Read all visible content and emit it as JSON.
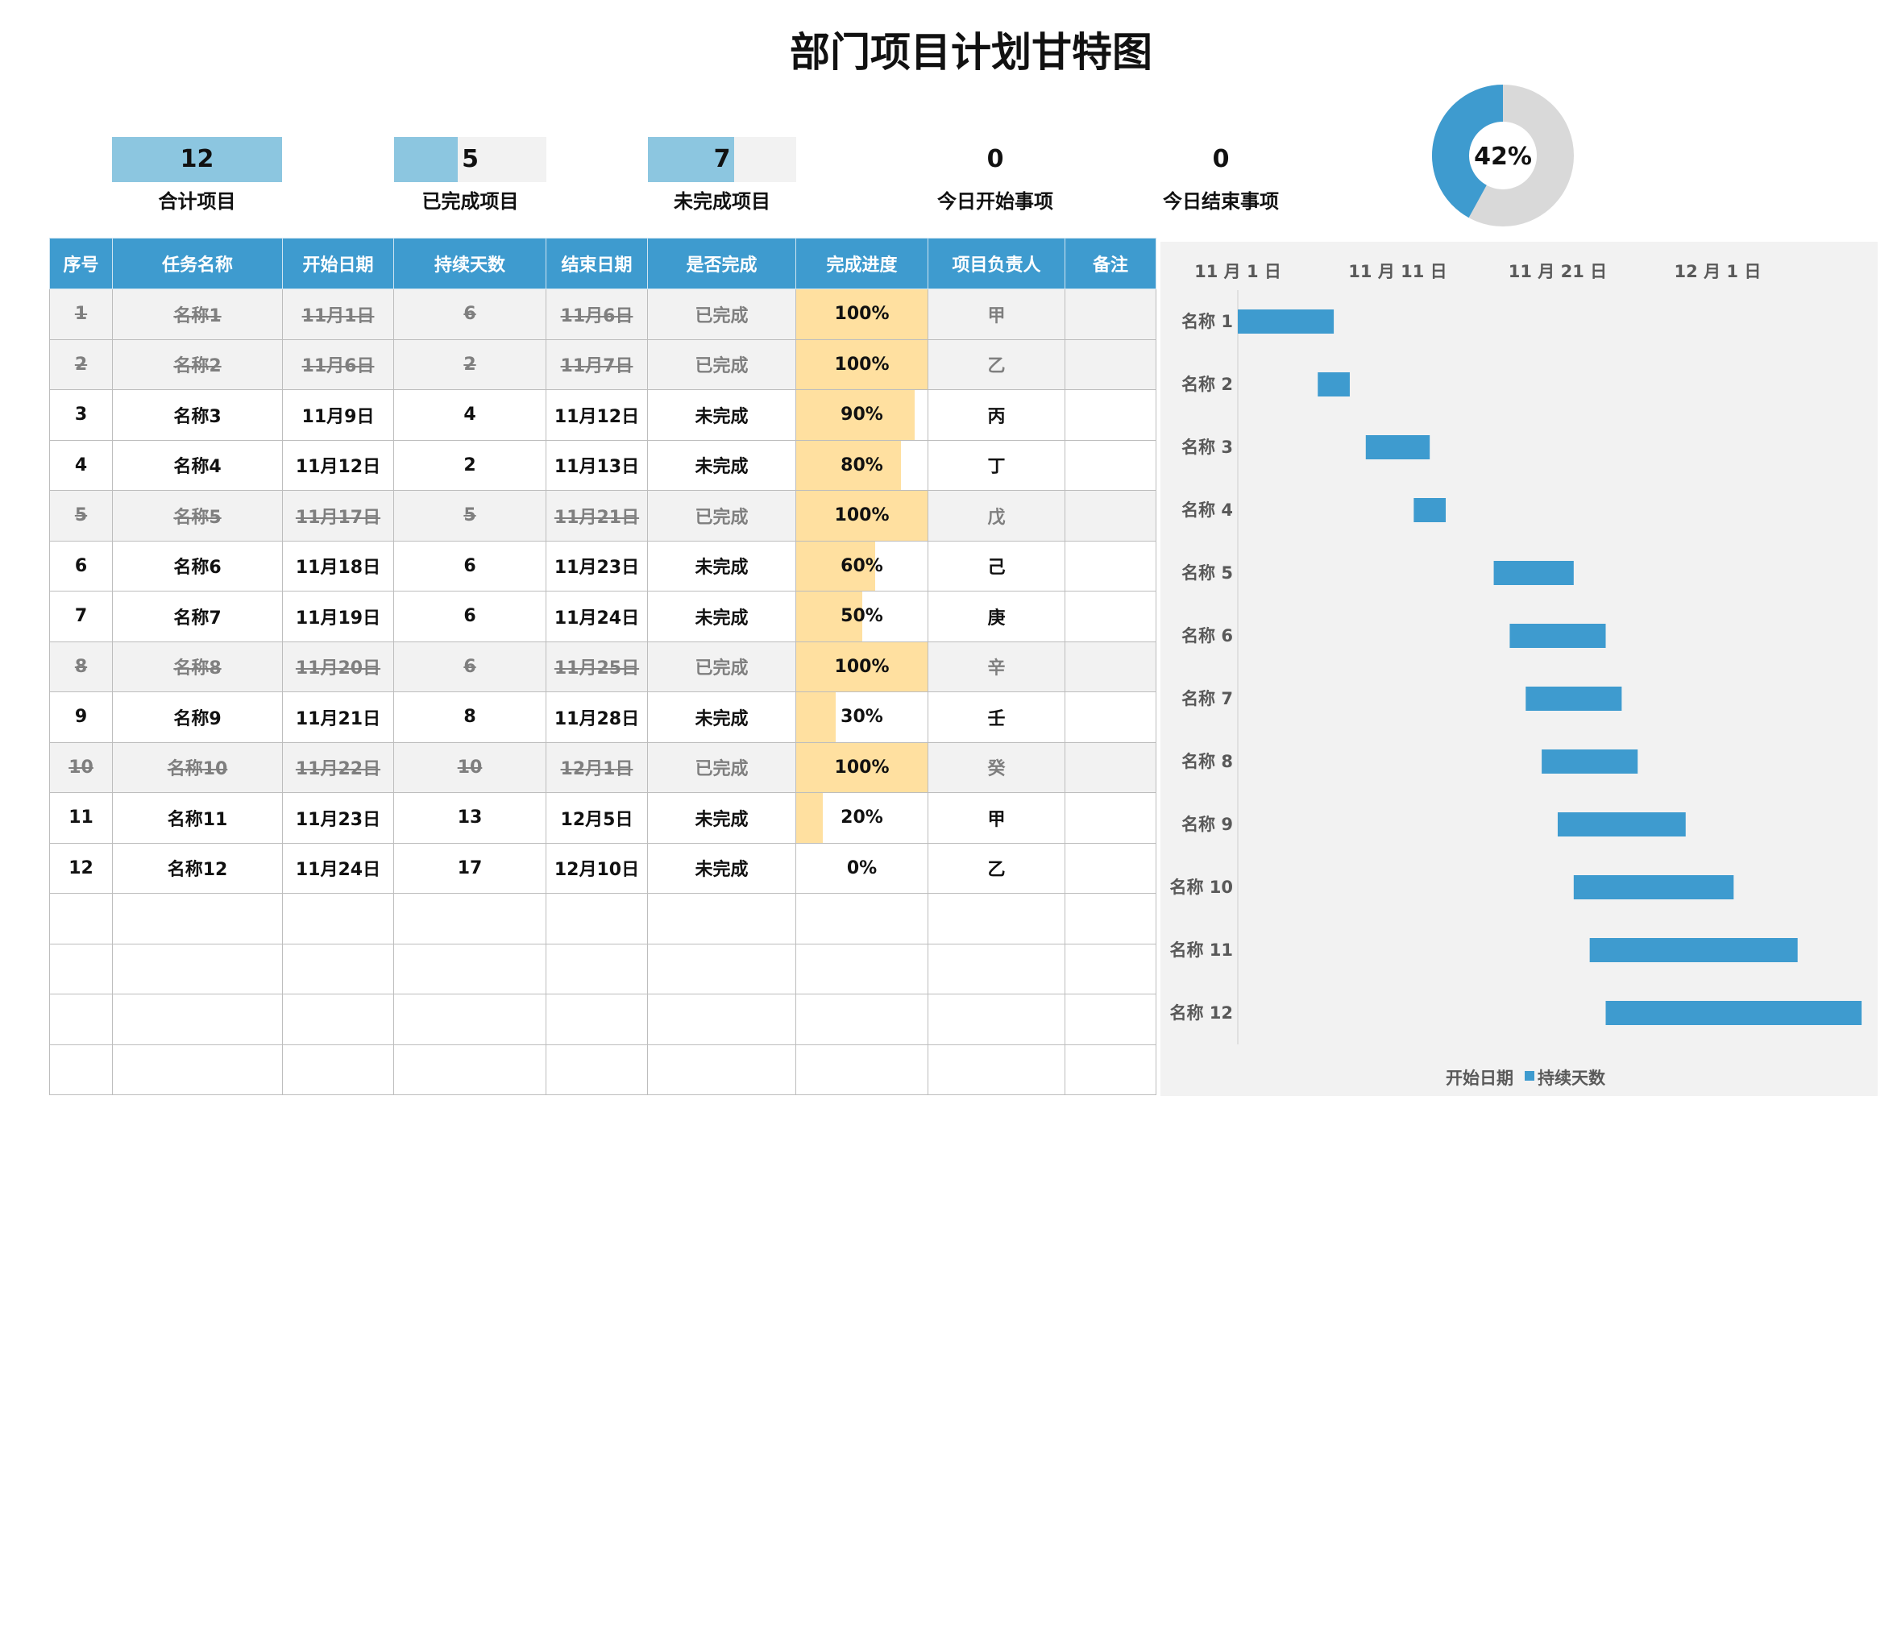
{
  "title": "部门项目计划甘特图",
  "kpis": [
    {
      "value": "12",
      "label": "合计项目",
      "fill": 1.0
    },
    {
      "value": "5",
      "label": "已完成项目",
      "fill": 0.4167
    },
    {
      "value": "7",
      "label": "未完成项目",
      "fill": 0.5833
    },
    {
      "value": "0",
      "label": "今日开始事项"
    },
    {
      "value": "0",
      "label": "今日结束事项"
    }
  ],
  "donut": {
    "label": "42%",
    "value": 0.42,
    "color_done": "#3e9bcf",
    "color_rest": "#d9d9d9"
  },
  "table": {
    "headers": [
      "序号",
      "任务名称",
      "开始日期",
      "持续天数",
      "结束日期",
      "是否完成",
      "完成进度",
      "项目负责人",
      "备注"
    ],
    "rows": [
      {
        "no": "1",
        "name": "名称1",
        "start": "11月1日",
        "days": "6",
        "end": "11月6日",
        "status": "已完成",
        "progress": "100%",
        "pct": 1.0,
        "owner": "甲",
        "note": "",
        "done": true
      },
      {
        "no": "2",
        "name": "名称2",
        "start": "11月6日",
        "days": "2",
        "end": "11月7日",
        "status": "已完成",
        "progress": "100%",
        "pct": 1.0,
        "owner": "乙",
        "note": "",
        "done": true
      },
      {
        "no": "3",
        "name": "名称3",
        "start": "11月9日",
        "days": "4",
        "end": "11月12日",
        "status": "未完成",
        "progress": "90%",
        "pct": 0.9,
        "owner": "丙",
        "note": "",
        "done": false
      },
      {
        "no": "4",
        "name": "名称4",
        "start": "11月12日",
        "days": "2",
        "end": "11月13日",
        "status": "未完成",
        "progress": "80%",
        "pct": 0.8,
        "owner": "丁",
        "note": "",
        "done": false
      },
      {
        "no": "5",
        "name": "名称5",
        "start": "11月17日",
        "days": "5",
        "end": "11月21日",
        "status": "已完成",
        "progress": "100%",
        "pct": 1.0,
        "owner": "戊",
        "note": "",
        "done": true
      },
      {
        "no": "6",
        "name": "名称6",
        "start": "11月18日",
        "days": "6",
        "end": "11月23日",
        "status": "未完成",
        "progress": "60%",
        "pct": 0.6,
        "owner": "己",
        "note": "",
        "done": false
      },
      {
        "no": "7",
        "name": "名称7",
        "start": "11月19日",
        "days": "6",
        "end": "11月24日",
        "status": "未完成",
        "progress": "50%",
        "pct": 0.5,
        "owner": "庚",
        "note": "",
        "done": false
      },
      {
        "no": "8",
        "name": "名称8",
        "start": "11月20日",
        "days": "6",
        "end": "11月25日",
        "status": "已完成",
        "progress": "100%",
        "pct": 1.0,
        "owner": "辛",
        "note": "",
        "done": true
      },
      {
        "no": "9",
        "name": "名称9",
        "start": "11月21日",
        "days": "8",
        "end": "11月28日",
        "status": "未完成",
        "progress": "30%",
        "pct": 0.3,
        "owner": "壬",
        "note": "",
        "done": false
      },
      {
        "no": "10",
        "name": "名称10",
        "start": "11月22日",
        "days": "10",
        "end": "12月1日",
        "status": "已完成",
        "progress": "100%",
        "pct": 1.0,
        "owner": "癸",
        "note": "",
        "done": true
      },
      {
        "no": "11",
        "name": "名称11",
        "start": "11月23日",
        "days": "13",
        "end": "12月5日",
        "status": "未完成",
        "progress": "20%",
        "pct": 0.2,
        "owner": "甲",
        "note": "",
        "done": false
      },
      {
        "no": "12",
        "name": "名称12",
        "start": "11月24日",
        "days": "17",
        "end": "12月10日",
        "status": "未完成",
        "progress": "0%",
        "pct": 0.0,
        "owner": "乙",
        "note": "",
        "done": false
      }
    ],
    "empty_rows": 4
  },
  "chart_data": {
    "type": "bar",
    "orientation": "horizontal-stacked",
    "categories": [
      "名称 1",
      "名称 2",
      "名称 3",
      "名称 4",
      "名称 5",
      "名称 6",
      "名称 7",
      "名称 8",
      "名称 9",
      "名称 10",
      "名称 11",
      "名称 12"
    ],
    "series": [
      {
        "name": "开始日期",
        "values": [
          "11-01",
          "11-06",
          "11-09",
          "11-12",
          "11-17",
          "11-18",
          "11-19",
          "11-20",
          "11-21",
          "11-22",
          "11-23",
          "11-24"
        ],
        "color": "none"
      },
      {
        "name": "持续天数",
        "values": [
          6,
          2,
          4,
          2,
          5,
          6,
          6,
          6,
          8,
          10,
          13,
          16
        ],
        "color": "#3e9bcf"
      }
    ],
    "x_tick_labels": [
      "11 月 1 日",
      "11 月 11 日",
      "11 月 21 日",
      "12 月 1 日"
    ],
    "x_range": [
      "11-01",
      "12-10"
    ],
    "axis_position": "top",
    "grid": false,
    "legend": "bottom"
  }
}
